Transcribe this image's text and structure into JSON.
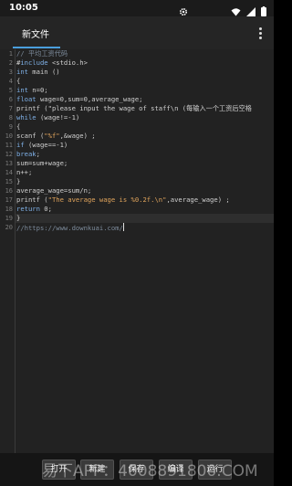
{
  "status_bar": {
    "time": "10:05",
    "colors": {
      "background": "#1b1b1b",
      "text": "#ffffff"
    },
    "icons": [
      "settings-gear-icon",
      "wifi-icon",
      "cell-signal-icon",
      "battery-icon"
    ]
  },
  "app_bar": {
    "tab_label": "新文件",
    "active_tab_color": "#4a9fdd",
    "menu_icon": "more-vert-icon"
  },
  "editor": {
    "line_numbers": [
      "1",
      "2",
      "3",
      "4",
      "5",
      "6",
      "7",
      "8",
      "9",
      "10",
      "11",
      "12",
      "13",
      "14",
      "15",
      "16",
      "17",
      "18",
      "19",
      "20"
    ],
    "lines": [
      "// 平均工资代码",
      "#include <stdio.h>",
      "int main ()",
      "{",
      "int n=0;",
      "float wage=0,sum=0,average_wage;",
      "printf (\"please input the wage of staff\\n (每输入一个工资后空格",
      "while (wage!=-1)",
      "{",
      "scanf (\"%f\",&wage) ;",
      "if (wage==-1)",
      "break;",
      "sum=sum+wage;",
      "n++;",
      "}",
      "average_wage=sum/n;",
      "printf (\"The average wage is %0.2f.\\n\",average_wage) ;",
      "return 0;",
      "}",
      "//https://www.downkuai.com/"
    ],
    "current_line": 20,
    "colors": {
      "keyword": "#7fb0e6",
      "comment": "#7c8a9a",
      "string": "#e0a45c",
      "number": "#8fc47f",
      "text": "#cfcfcf",
      "background": "#222222"
    }
  },
  "bottom_bar": {
    "buttons": [
      "打开",
      "新建",
      "保存",
      "编译",
      "运行"
    ],
    "watermark": "易下APP：4008891800.COM"
  }
}
